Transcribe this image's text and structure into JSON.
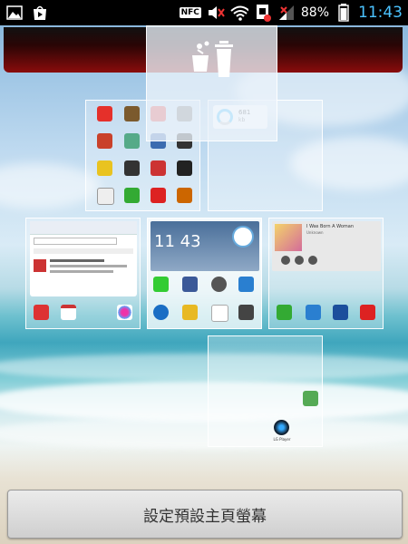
{
  "status_bar": {
    "battery_percent": "88%",
    "time": "11:43",
    "nfc_label": "NFC",
    "icons": [
      "gallery-icon",
      "play-store-icon",
      "nfc-icon",
      "mute-icon",
      "wifi-icon",
      "sim-icon",
      "signal-icon",
      "battery-icon"
    ]
  },
  "trash": {
    "icon": "trash-icon"
  },
  "pages": {
    "clock_widget": {
      "time": "11 43"
    },
    "widget_2_lines": [
      "681",
      "kb"
    ],
    "music_widget": {
      "title": "I Was Born A Woman",
      "artist": "Unknown"
    },
    "page_5_dock_label": "LG Player"
  },
  "bottom_button": {
    "label": "設定預設主頁螢幕"
  },
  "colors": {
    "clock_text": "#4bc3ff",
    "trash_bar": "#8a0c0c"
  }
}
